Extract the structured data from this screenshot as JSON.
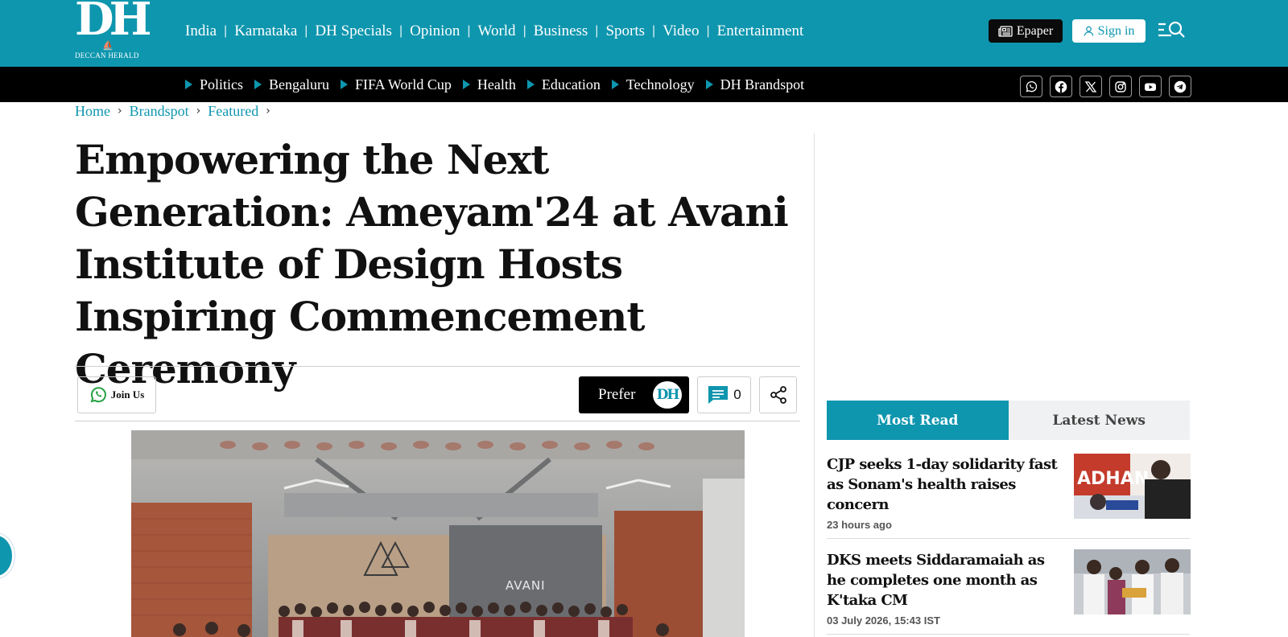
{
  "colors": {
    "brand": "#0e96ae",
    "header_bg": "#0e96ae",
    "subnav_bg": "#000000",
    "text": "#111111"
  },
  "logo": {
    "mark": "DH",
    "tagline": "DECCAN HERALD"
  },
  "main_nav": [
    "India",
    "Karnataka",
    "DH Specials",
    "Opinion",
    "World",
    "Business",
    "Sports",
    "Video",
    "Entertainment"
  ],
  "header_actions": {
    "epaper_label": "Epaper",
    "signin_label": "Sign in",
    "menu_icon": "menu-search-icon"
  },
  "sub_nav": [
    "Politics",
    "Bengaluru",
    "FIFA World Cup",
    "Health",
    "Education",
    "Technology",
    "DH Brandspot"
  ],
  "social": [
    "whatsapp-icon",
    "facebook-icon",
    "x-icon",
    "instagram-icon",
    "youtube-icon",
    "telegram-icon"
  ],
  "breadcrumb": [
    "Home",
    "Brandspot",
    "Featured"
  ],
  "article": {
    "title": "Empowering the Next Generation: Ameyam'24 at Avani Institute of Design Hosts Inspiring Commencement Ceremony",
    "join_label": "Join Us",
    "prefer_label": "Prefer",
    "prefer_badge": "DH",
    "comment_count": "0",
    "photo_sign": "AVANI"
  },
  "sidebar": {
    "tabs": [
      {
        "label": "Most Read",
        "active": true
      },
      {
        "label": "Latest News",
        "active": false
      }
    ],
    "items": [
      {
        "title": "CJP seeks 1-day solidarity fast as Sonam's health raises concern",
        "time": "23 hours ago",
        "thumb_text": "ADHAN"
      },
      {
        "title": "DKS meets Siddaramaiah as he completes one month as K'taka CM",
        "time": "03 July 2026, 15:43 IST"
      }
    ]
  }
}
